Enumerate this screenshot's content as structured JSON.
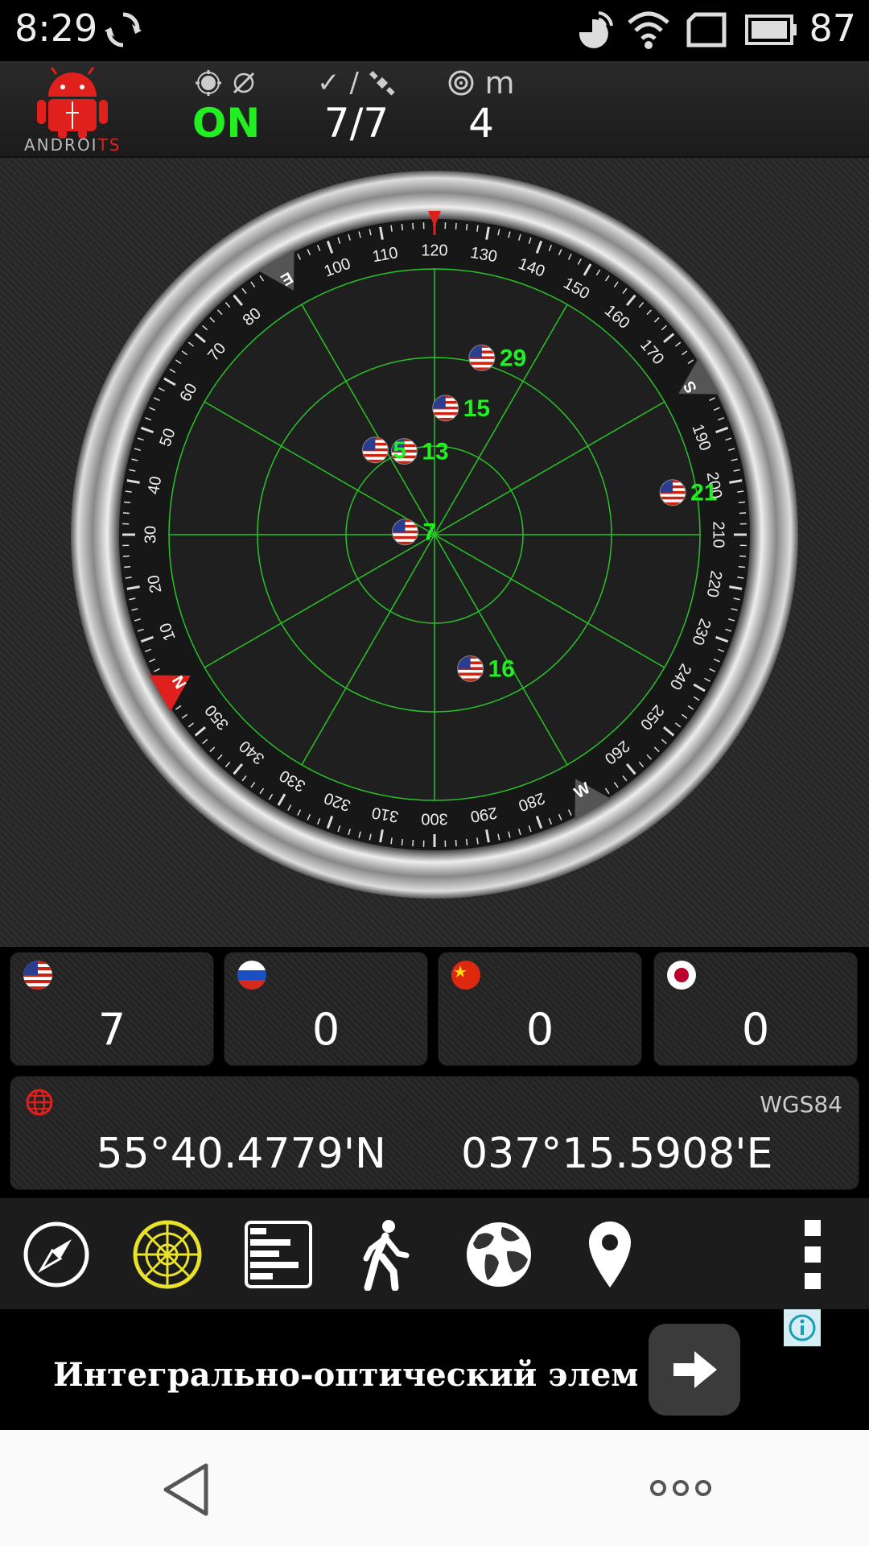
{
  "status_bar": {
    "time": "8:29",
    "battery": "87",
    "icons": [
      "sync-icon",
      "location-icon",
      "wifi-icon",
      "tablet-icon",
      "battery-icon"
    ]
  },
  "header": {
    "logo_text_a": "ANDROI",
    "logo_text_b": "TS",
    "gps_state": "ON",
    "sats_used": "7/7",
    "accuracy_unit": "m",
    "accuracy_value": "4"
  },
  "radar": {
    "cardinals": [
      "N",
      "E",
      "S",
      "W"
    ],
    "satellites": [
      {
        "prn": "15",
        "az": 125,
        "el": 47
      },
      {
        "prn": "13",
        "az": 100,
        "el": 60
      },
      {
        "prn": "29",
        "az": 135,
        "el": 28
      },
      {
        "prn": "5",
        "az": 85,
        "el": 55
      },
      {
        "prn": "21",
        "az": 200,
        "el": 8
      },
      {
        "prn": "7",
        "az": 35,
        "el": 80
      },
      {
        "prn": "16",
        "az": 285,
        "el": 43
      }
    ]
  },
  "constellations": [
    {
      "name": "GPS",
      "flag": "us",
      "count": "7"
    },
    {
      "name": "GLONASS",
      "flag": "ru",
      "count": "0"
    },
    {
      "name": "BeiDou",
      "flag": "cn",
      "count": "0"
    },
    {
      "name": "QZSS",
      "flag": "jp",
      "count": "0"
    }
  ],
  "position": {
    "datum": "WGS84",
    "lat": "55°40.4779'N",
    "lon": "037°15.5908'E"
  },
  "toolbar": {
    "icons": [
      "compass-icon",
      "radar-icon",
      "signal-bars-icon",
      "walking-icon",
      "globe-icon",
      "map-pin-icon",
      "overflow-menu-icon"
    ]
  },
  "ad": {
    "text": "Интегрально-оптический элемент"
  },
  "colors": {
    "accent_green": "#22ee22",
    "brand_red": "#e0201c",
    "radar_bg": "#1f1f1f"
  }
}
